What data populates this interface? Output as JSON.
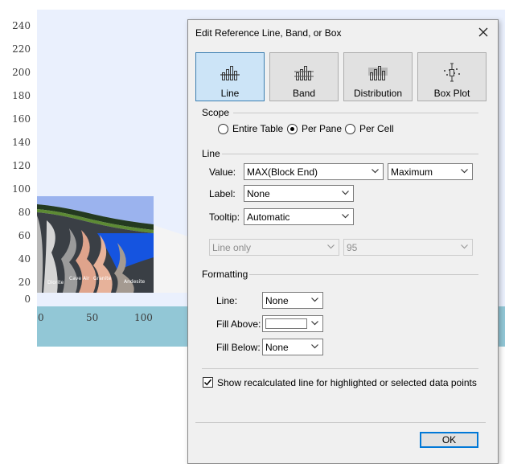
{
  "chart": {
    "y_ticks": [
      "240",
      "220",
      "200",
      "180",
      "160",
      "140",
      "120",
      "100",
      "80",
      "60",
      "40",
      "20",
      "0"
    ],
    "x_ticks": [
      "0",
      "50",
      "100"
    ],
    "area_labels": [
      "Diorite",
      "Cave Air",
      "Granite",
      "Andesite"
    ]
  },
  "dialog": {
    "title": "Edit Reference Line, Band, or Box",
    "types": [
      {
        "label": "Line",
        "icon": "line-chart-icon",
        "selected": true
      },
      {
        "label": "Band",
        "icon": "band-chart-icon",
        "selected": false
      },
      {
        "label": "Distribution",
        "icon": "distribution-chart-icon",
        "selected": false
      },
      {
        "label": "Box Plot",
        "icon": "box-plot-icon",
        "selected": false
      }
    ],
    "scope": {
      "title": "Scope",
      "options": [
        "Entire Table",
        "Per Pane",
        "Per Cell"
      ],
      "selected": "Per Pane"
    },
    "line": {
      "title": "Line",
      "value_label": "Value:",
      "value_field": "MAX(Block  End)",
      "value_agg": "Maximum",
      "label_label": "Label:",
      "label_value": "None",
      "tooltip_label": "Tooltip:",
      "tooltip_value": "Automatic",
      "confidence_mode": "Line only",
      "confidence_value": "95"
    },
    "formatting": {
      "title": "Formatting",
      "line_label": "Line:",
      "line_value": "None",
      "fill_above_label": "Fill Above:",
      "fill_above_color": "#ffffff",
      "fill_below_label": "Fill Below:",
      "fill_below_value": "None"
    },
    "recalc": {
      "label": "Show recalculated line for highlighted or selected data points",
      "checked": true
    },
    "ok_label": "OK"
  },
  "colors": {
    "selected_bg": "#cce4f7",
    "selected_border": "#3c7fb1",
    "ok_border": "#0078d7"
  }
}
